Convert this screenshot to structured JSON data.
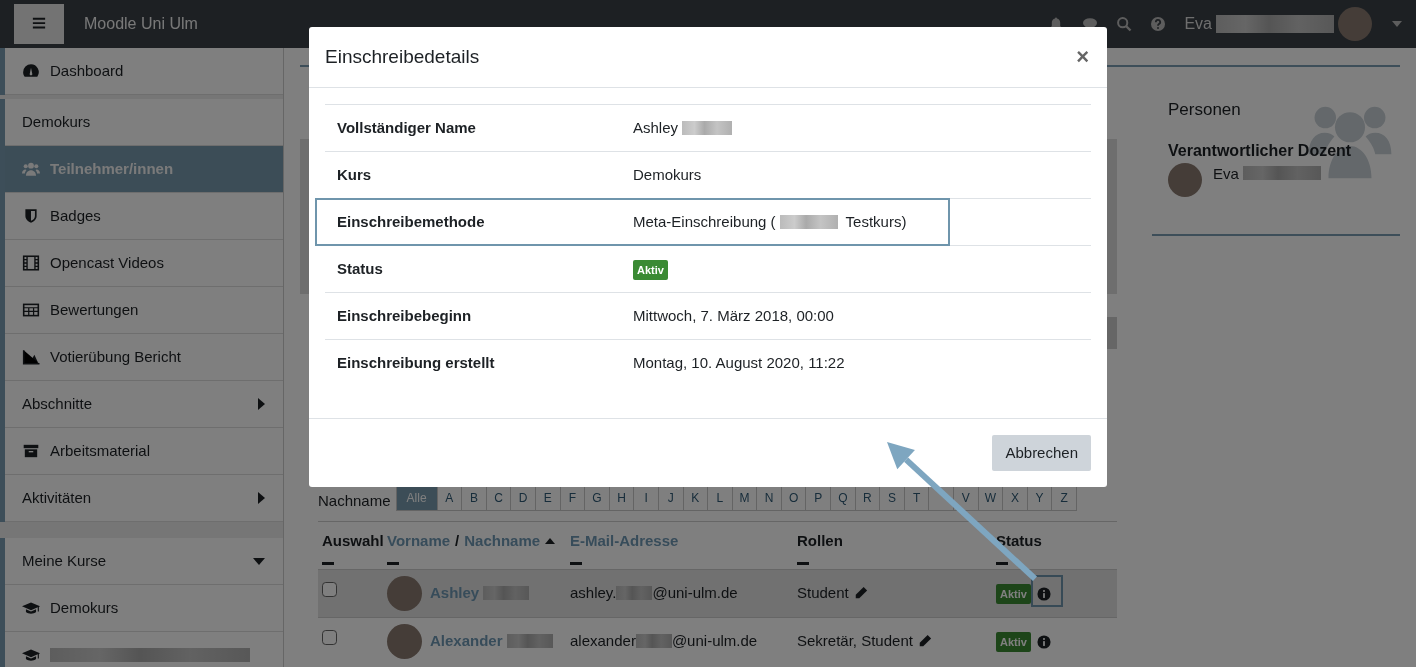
{
  "navbar": {
    "brand": "Moodle Uni Ulm",
    "user_name": "Eva"
  },
  "sidebar": {
    "groups": [
      {
        "items": [
          {
            "label": "Dashboard",
            "kind": "icon-link",
            "selected": false
          }
        ]
      },
      {
        "items": [
          {
            "label": "Demokurs",
            "kind": "plain",
            "selected": false
          },
          {
            "label": "Teilnehmer/innen",
            "kind": "icon-link",
            "selected": true
          },
          {
            "label": "Badges",
            "kind": "icon-link",
            "selected": false
          },
          {
            "label": "Opencast Videos",
            "kind": "icon-link",
            "selected": false
          },
          {
            "label": "Bewertungen",
            "kind": "icon-link",
            "selected": false
          },
          {
            "label": "Votierübung Bericht",
            "kind": "icon-link",
            "selected": false
          },
          {
            "label": "Abschnitte",
            "kind": "expandable",
            "selected": false,
            "expanded": false
          },
          {
            "label": "Arbeitsmaterial",
            "kind": "icon-link",
            "selected": false
          },
          {
            "label": "Aktivitäten",
            "kind": "expandable",
            "selected": false,
            "expanded": false
          }
        ]
      },
      {
        "items": [
          {
            "label": "Meine Kurse",
            "kind": "expandable",
            "selected": false,
            "expanded": true
          },
          {
            "label": "Demokurs",
            "kind": "icon-link",
            "selected": false
          },
          {
            "kind": "redacted-link",
            "selected": false
          }
        ]
      }
    ]
  },
  "personen": {
    "title": "Personen",
    "heading": "Verantwortlicher Dozent",
    "person": "Eva"
  },
  "initials": {
    "label": "Nachname",
    "letters": [
      {
        "label": "Alle",
        "selected": true
      },
      {
        "label": "A",
        "selected": false
      },
      {
        "label": "B",
        "selected": false
      },
      {
        "label": "C",
        "selected": false
      },
      {
        "label": "D",
        "selected": false
      },
      {
        "label": "E",
        "selected": false
      },
      {
        "label": "F",
        "selected": false
      },
      {
        "label": "G",
        "selected": false
      },
      {
        "label": "H",
        "selected": false
      },
      {
        "label": "I",
        "selected": false
      },
      {
        "label": "J",
        "selected": false
      },
      {
        "label": "K",
        "selected": false
      },
      {
        "label": "L",
        "selected": false
      },
      {
        "label": "M",
        "selected": false
      },
      {
        "label": "N",
        "selected": false
      },
      {
        "label": "O",
        "selected": false
      },
      {
        "label": "P",
        "selected": false
      },
      {
        "label": "Q",
        "selected": false
      },
      {
        "label": "R",
        "selected": false
      },
      {
        "label": "S",
        "selected": false
      },
      {
        "label": "T",
        "selected": false
      },
      {
        "covered": true,
        "selected": false
      },
      {
        "label": "V",
        "selected": false
      },
      {
        "label": "W",
        "selected": false
      },
      {
        "label": "X",
        "selected": false
      },
      {
        "label": "Y",
        "selected": false
      },
      {
        "label": "Z",
        "selected": false
      }
    ]
  },
  "table": {
    "columns": [
      {
        "parts": [
          {
            "text": "Auswahl",
            "link": false
          }
        ]
      },
      {
        "parts": [
          {
            "text": "Vorname",
            "link": true
          },
          {
            "text": "/",
            "link": false
          },
          {
            "text": "Nachname",
            "link": true
          }
        ],
        "sorted": true
      },
      {
        "parts": [
          {
            "text": "E-Mail-Adresse",
            "link": true
          }
        ]
      },
      {
        "parts": [
          {
            "text": "Rollen",
            "link": false
          }
        ]
      },
      {
        "parts": [
          {
            "text": "Status",
            "link": false
          }
        ]
      }
    ],
    "rows": [
      {
        "selected": false,
        "hovered": true,
        "name": "Ashley",
        "email_start": "ashley.",
        "email_end": "@uni-ulm.de",
        "roles": "Student",
        "status": "Aktiv",
        "highlighted": true
      },
      {
        "selected": false,
        "hovered": false,
        "name": "Alexander",
        "email_start": "alexander",
        "email_end": "@uni-ulm.de",
        "roles": "Sekretär, Student",
        "status": "Aktiv",
        "highlighted": false
      }
    ]
  },
  "modal": {
    "title": "Einschreibedetails",
    "close": "×",
    "rows": [
      {
        "label": "Vollständiger Name",
        "kind": "text",
        "value": "Ashley",
        "redacted": true,
        "highlighted": false
      },
      {
        "label": "Kurs",
        "kind": "text",
        "value": "Demokurs",
        "redacted": false,
        "highlighted": false
      },
      {
        "label": "Einschreibemethode",
        "kind": "text",
        "value": "Meta-Einschreibung (",
        "redacted": true,
        "value_after": "Testkurs)",
        "highlighted": true
      },
      {
        "label": "Status",
        "kind": "badge",
        "value": "Aktiv",
        "redacted": false,
        "highlighted": false
      },
      {
        "label": "Einschreibebeginn",
        "kind": "text",
        "value": "Mittwoch, 7. März 2018, 00:00",
        "redacted": false,
        "highlighted": false
      },
      {
        "label": "Einschreibung erstellt",
        "kind": "text",
        "value": "Montag, 10. August 2020, 11:22",
        "redacted": false,
        "highlighted": false
      }
    ],
    "buttons": [
      "Abbrechen"
    ]
  }
}
